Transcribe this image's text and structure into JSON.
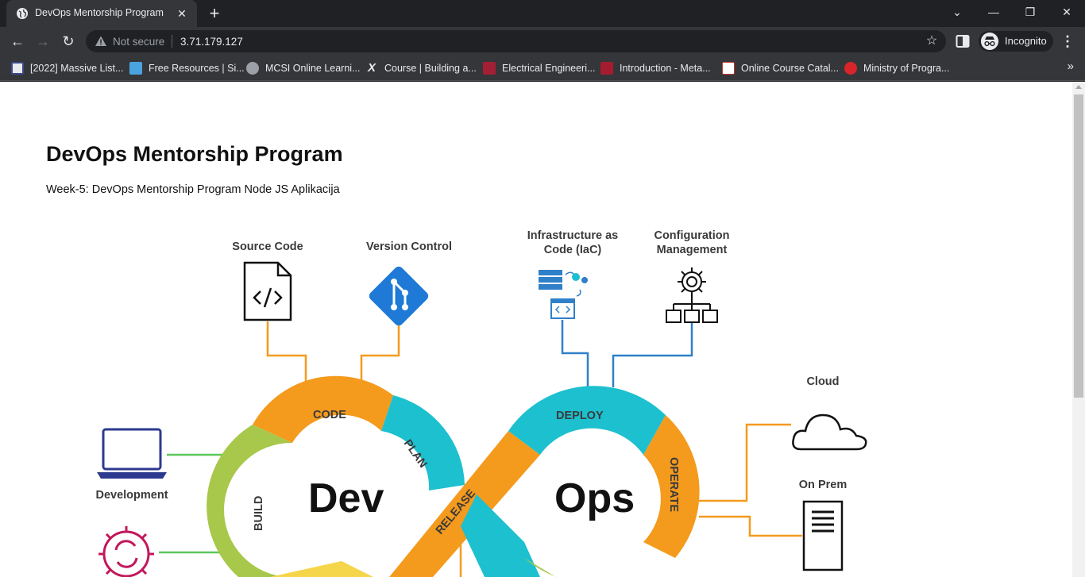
{
  "browser": {
    "tab": {
      "title": "DevOps Mentorship Program"
    },
    "omnibox": {
      "security": "Not secure",
      "url": "3.71.179.127"
    },
    "profile": {
      "label": "Incognito"
    },
    "bookmarks": [
      {
        "label": "[2022] Massive List...",
        "icon": "ic-logo-icon",
        "color": "#3b4a8a"
      },
      {
        "label": "Free Resources | Si...",
        "icon": "simplilearn-icon",
        "color": "#4aa3df"
      },
      {
        "label": "MCSI Online Learni...",
        "icon": "globe-icon",
        "color": "#9aa0a6"
      },
      {
        "label": "Course | Building a...",
        "icon": "edx-x-icon",
        "color": "#e8eaed"
      },
      {
        "label": "Electrical Engineeri...",
        "icon": "mit-ocw-icon",
        "color": "#a31f34"
      },
      {
        "label": "Introduction - Meta...",
        "icon": "harvard-icon",
        "color": "#a51c30"
      },
      {
        "label": "Online Course Catal...",
        "icon": "cisco-icon",
        "color": "#ffffff"
      },
      {
        "label": "Ministry of Progra...",
        "icon": "ministry-icon",
        "color": "#d9252a"
      }
    ]
  },
  "page": {
    "title": "DevOps Mentorship Program",
    "subtitle": "Week-5: DevOps Mentorship Program Node JS Aplikacija"
  },
  "diagram": {
    "tools": {
      "source_code": "Source Code",
      "version_control": "Version Control",
      "iac_line1": "Infrastructure as",
      "iac_line2": "Code (IaC)",
      "config_line1": "Configuration",
      "config_line2": "Management",
      "cloud": "Cloud",
      "on_prem": "On Prem",
      "development": "Development"
    },
    "stages": {
      "code": "CODE",
      "plan": "PLAN",
      "build": "BUILD",
      "release": "RELEASE",
      "deploy": "DEPLOY",
      "operate": "OPERATE"
    },
    "loops": {
      "dev": "Dev",
      "ops": "Ops"
    },
    "colors": {
      "orange": "#f49a1d",
      "teal": "#1cc0cf",
      "green": "#a7c84a",
      "yellow": "#f5d54a",
      "blue": "#2f80c9",
      "connector_green": "#5cc75a",
      "navy": "#2b3a8f",
      "magenta": "#c2185b"
    }
  }
}
